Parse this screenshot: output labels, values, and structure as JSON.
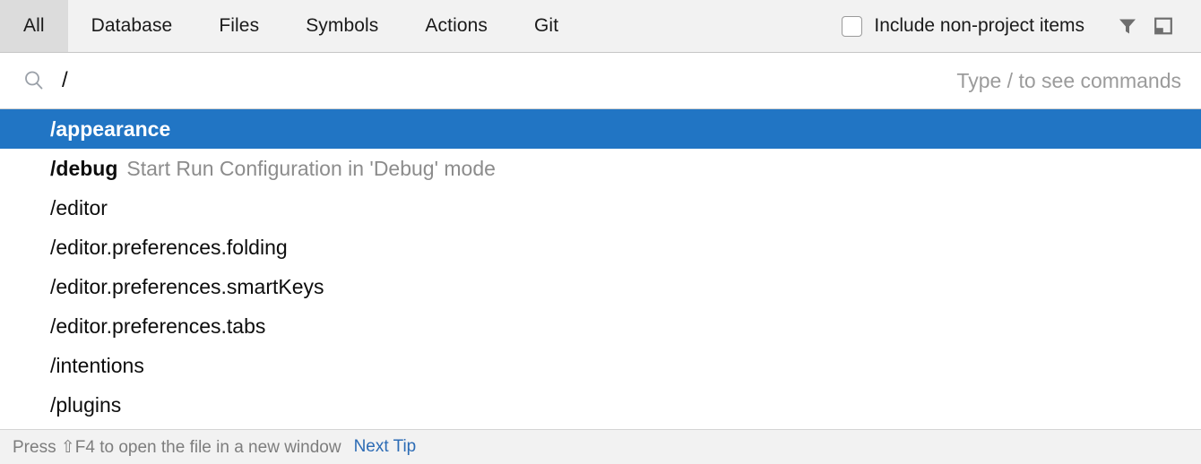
{
  "header": {
    "tabs": [
      {
        "label": "All",
        "selected": true
      },
      {
        "label": "Database",
        "selected": false
      },
      {
        "label": "Files",
        "selected": false
      },
      {
        "label": "Symbols",
        "selected": false
      },
      {
        "label": "Actions",
        "selected": false
      },
      {
        "label": "Git",
        "selected": false
      }
    ],
    "checkbox": {
      "label": "Include non-project items",
      "checked": false
    },
    "icons": [
      {
        "name": "filter-icon"
      },
      {
        "name": "preview-window-icon"
      }
    ],
    "colors": {
      "bar_background": "#f2f2f2",
      "selected_tab_background": "#dcdcdc"
    }
  },
  "search": {
    "icon": "search-icon",
    "value": "/",
    "hint": "Type / to see commands"
  },
  "results": [
    {
      "title": "/appearance",
      "description": "",
      "selected": true,
      "bold": true
    },
    {
      "title": "/debug",
      "description": "Start Run Configuration in 'Debug' mode",
      "selected": false,
      "bold": true
    },
    {
      "title": "/editor",
      "description": "",
      "selected": false,
      "bold": false
    },
    {
      "title": "/editor.preferences.folding",
      "description": "",
      "selected": false,
      "bold": false
    },
    {
      "title": "/editor.preferences.smartKeys",
      "description": "",
      "selected": false,
      "bold": false
    },
    {
      "title": "/editor.preferences.tabs",
      "description": "",
      "selected": false,
      "bold": false
    },
    {
      "title": "/intentions",
      "description": "",
      "selected": false,
      "bold": false
    },
    {
      "title": "/plugins",
      "description": "",
      "selected": false,
      "bold": false
    }
  ],
  "selection_color": "#2175c4",
  "status": {
    "tip_text": "Press ⇧F4 to open the file in a new window",
    "link_label": "Next Tip",
    "link_color": "#2d6cb5"
  }
}
